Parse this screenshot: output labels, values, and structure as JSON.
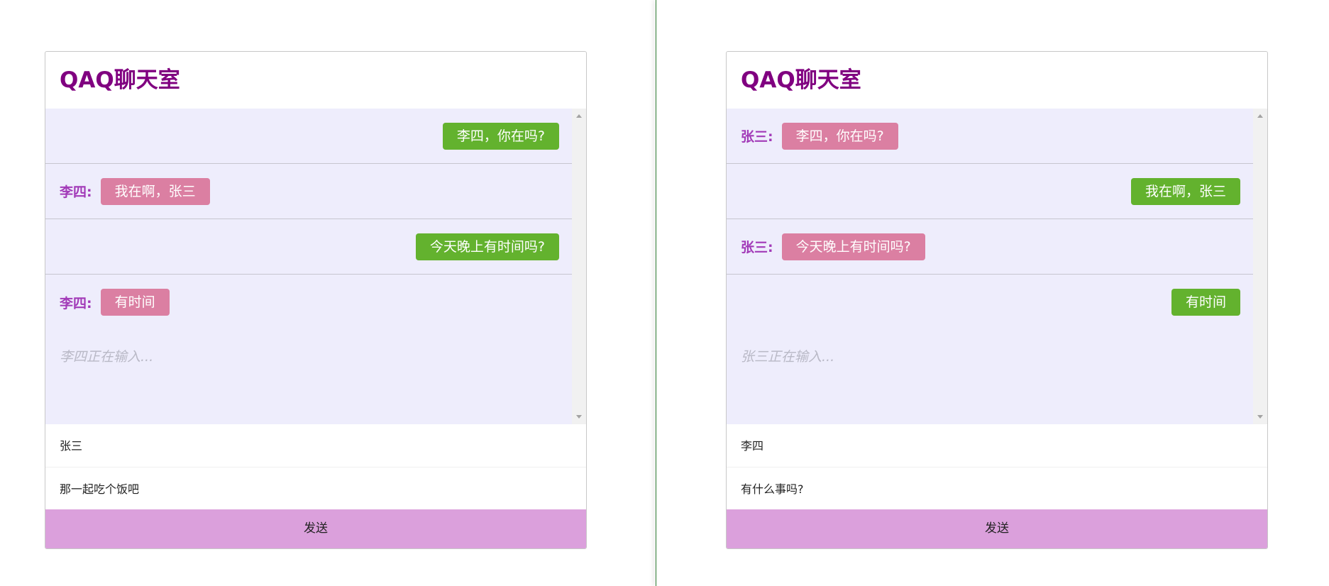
{
  "windows": [
    {
      "title": "QAQ聊天室",
      "messages": [
        {
          "side": "right",
          "sender": "",
          "text": "李四，你在吗?"
        },
        {
          "side": "left",
          "sender": "李四:",
          "text": "我在啊，张三"
        },
        {
          "side": "right",
          "sender": "",
          "text": "今天晚上有时间吗?"
        },
        {
          "side": "left",
          "sender": "李四:",
          "text": "有时间"
        }
      ],
      "typing": "李四正在输入...",
      "name_value": "张三",
      "message_value": "那一起吃个饭吧",
      "send_label": "发送"
    },
    {
      "title": "QAQ聊天室",
      "messages": [
        {
          "side": "left",
          "sender": "张三:",
          "text": "李四，你在吗?"
        },
        {
          "side": "right",
          "sender": "",
          "text": "我在啊，张三"
        },
        {
          "side": "left",
          "sender": "张三:",
          "text": "今天晚上有时间吗?"
        },
        {
          "side": "right",
          "sender": "",
          "text": "有时间"
        }
      ],
      "typing": "张三正在输入...",
      "name_value": "李四",
      "message_value": "有什么事吗?",
      "send_label": "发送"
    }
  ],
  "colors": {
    "title": "#800080",
    "sender": "#a23ab8",
    "bubble_own": "#63b22e",
    "bubble_other": "#db7fa2",
    "message_area": "#eeedfc",
    "send_button": "#dba0dc",
    "divider": "#2e7d32"
  }
}
